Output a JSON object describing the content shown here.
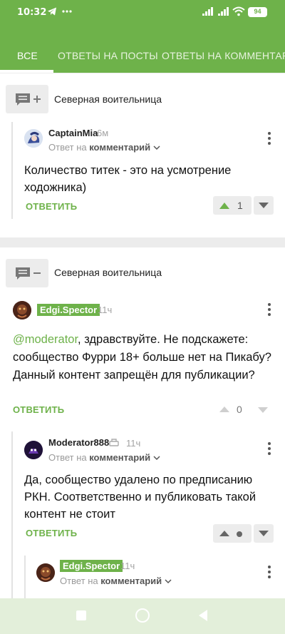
{
  "status": {
    "time": "10:32",
    "battery": "94"
  },
  "tabs": [
    {
      "label": "ВСЕ",
      "active": true
    },
    {
      "label": "ОТВЕТЫ НА ПОСТЫ",
      "active": false
    },
    {
      "label": "ОТВЕТЫ НА КОММЕНТАРИИ",
      "active": false
    }
  ],
  "comments": [
    {
      "group_title": "Северная воительница",
      "author": "CaptainMia",
      "time": "6м",
      "reply_prefix": "Ответ на ",
      "reply_target": "комментарий",
      "text": "Количество титек - это на усмотрение ходожника)",
      "answer_label": "ОТВЕТИТЬ",
      "rating": "1"
    },
    {
      "group_title": "Северная воительница",
      "author": "Edgi.Spector",
      "time": "11ч",
      "mention": "@moderator",
      "text": ", здравствуйте. Не подскажете: сообщество Фурри 18+ больше нет на Пикабу? Данный контент запрещён для публикации?",
      "answer_label": "ОТВЕТИТЬ",
      "rating": "0",
      "reply": {
        "author": "Moderator888",
        "time": "11ч",
        "reply_prefix": "Ответ на ",
        "reply_target": "комментарий",
        "text": "Да, сообщество удалено по предписанию РКН. Соответственно и публиковать такой контент не стоит",
        "answer_label": "ОТВЕТИТЬ"
      },
      "reply2": {
        "author": "Edgi.Spector",
        "time": "11ч",
        "reply_prefix": "Ответ на ",
        "reply_target": "комментарий"
      }
    }
  ],
  "colors": {
    "accent": "#6eb24a",
    "background": "#ececec"
  }
}
